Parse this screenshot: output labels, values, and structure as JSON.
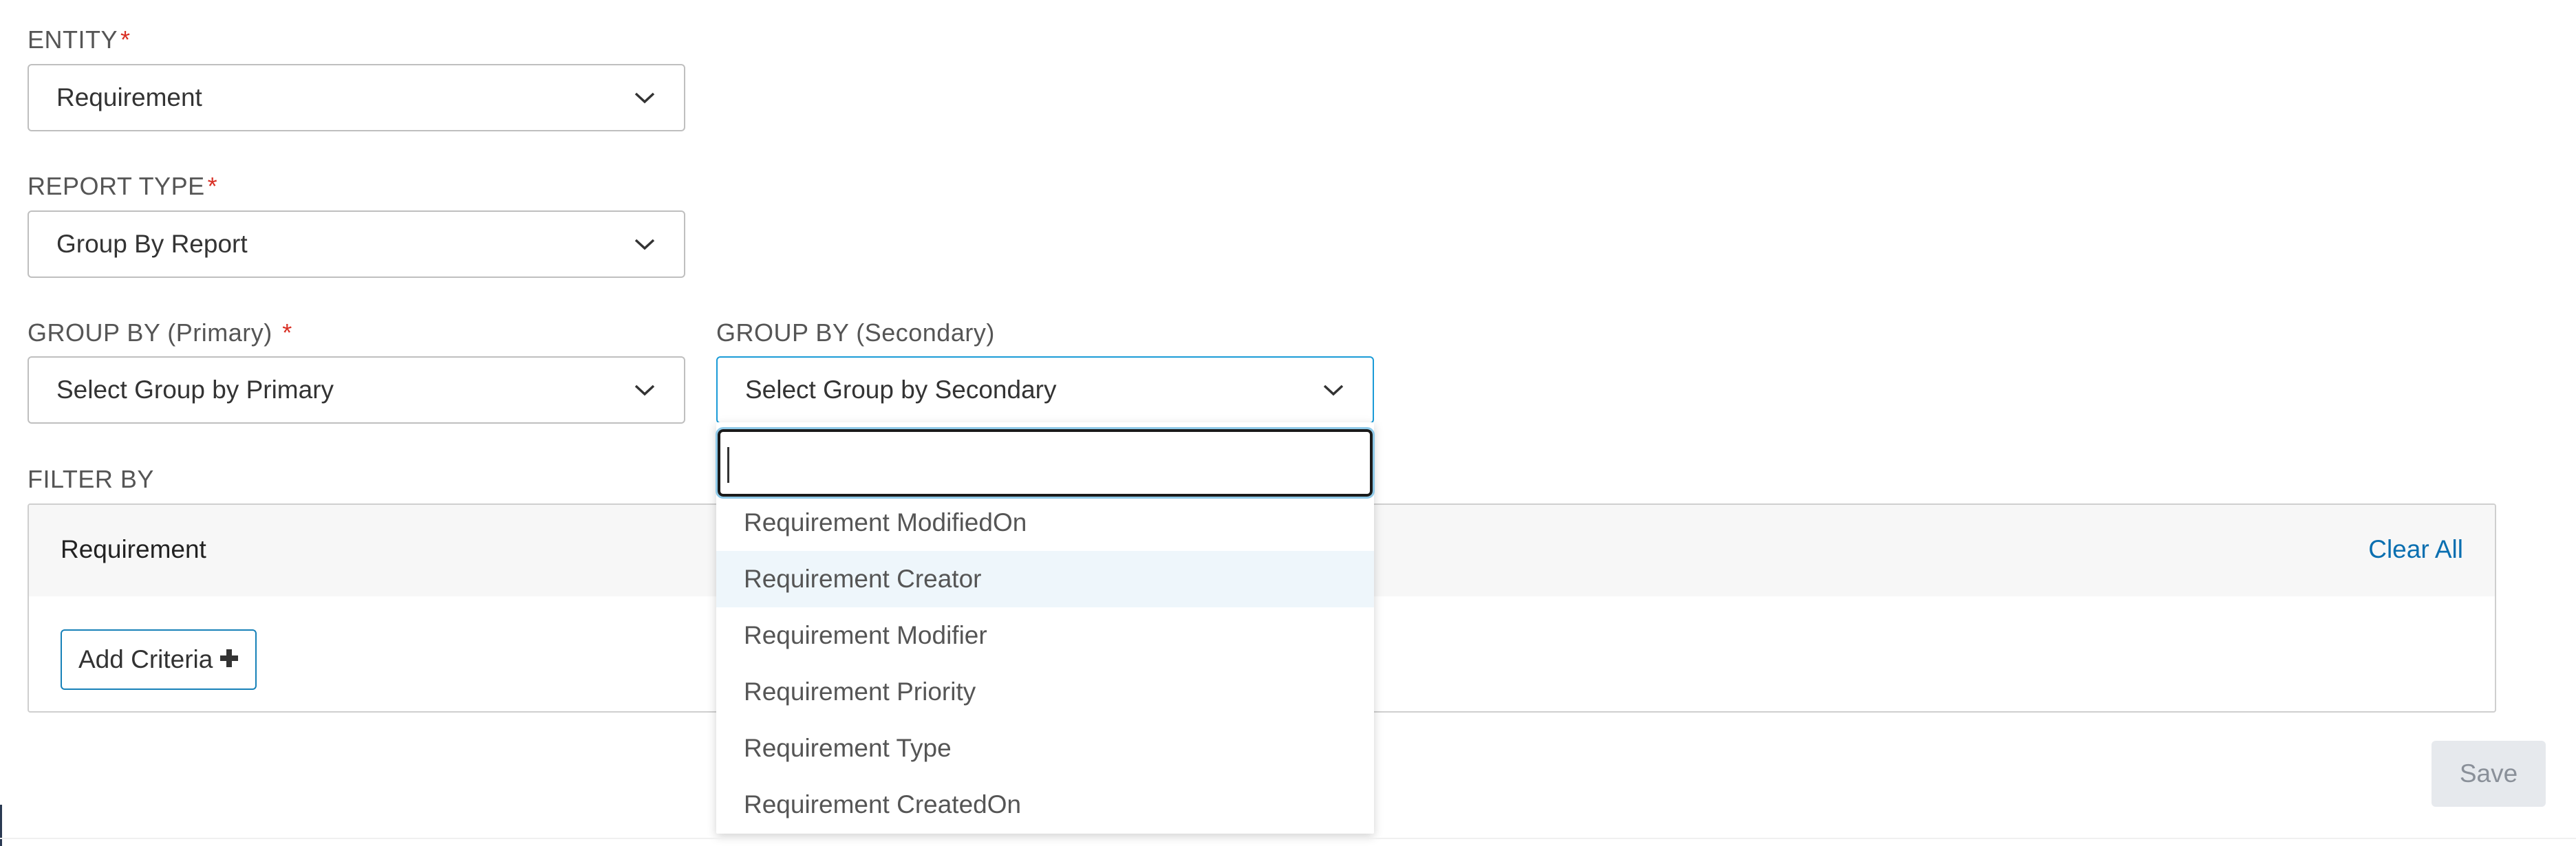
{
  "form": {
    "entity": {
      "label": "ENTITY",
      "required_mark": "*",
      "value": "Requirement"
    },
    "report_type": {
      "label": "REPORT TYPE",
      "required_mark": "*",
      "value": "Group By Report"
    },
    "group_primary": {
      "label": "GROUP BY (Primary)",
      "required_mark": "*",
      "placeholder": "Select Group by Primary"
    },
    "group_secondary": {
      "label": "GROUP BY (Secondary)",
      "placeholder": "Select Group by Secondary"
    }
  },
  "filter": {
    "label": "FILTER BY",
    "panel_title": "Requirement",
    "clear_all": "Clear All",
    "add_criteria": "Add Criteria",
    "add_icon": "plus-icon"
  },
  "dropdown": {
    "search_value": "",
    "options": [
      "Requirement ModifiedOn",
      "Requirement Creator",
      "Requirement Modifier",
      "Requirement Priority",
      "Requirement Type",
      "Requirement CreatedOn"
    ],
    "hovered_option": "Requirement Creator"
  },
  "actions": {
    "save": "Save"
  },
  "colors": {
    "required": "#d93025",
    "link": "#0a6fb0",
    "focus_border": "#1a9bd7",
    "hover_bg": "#eef6fb",
    "save_disabled_bg": "#e6e9ed"
  }
}
